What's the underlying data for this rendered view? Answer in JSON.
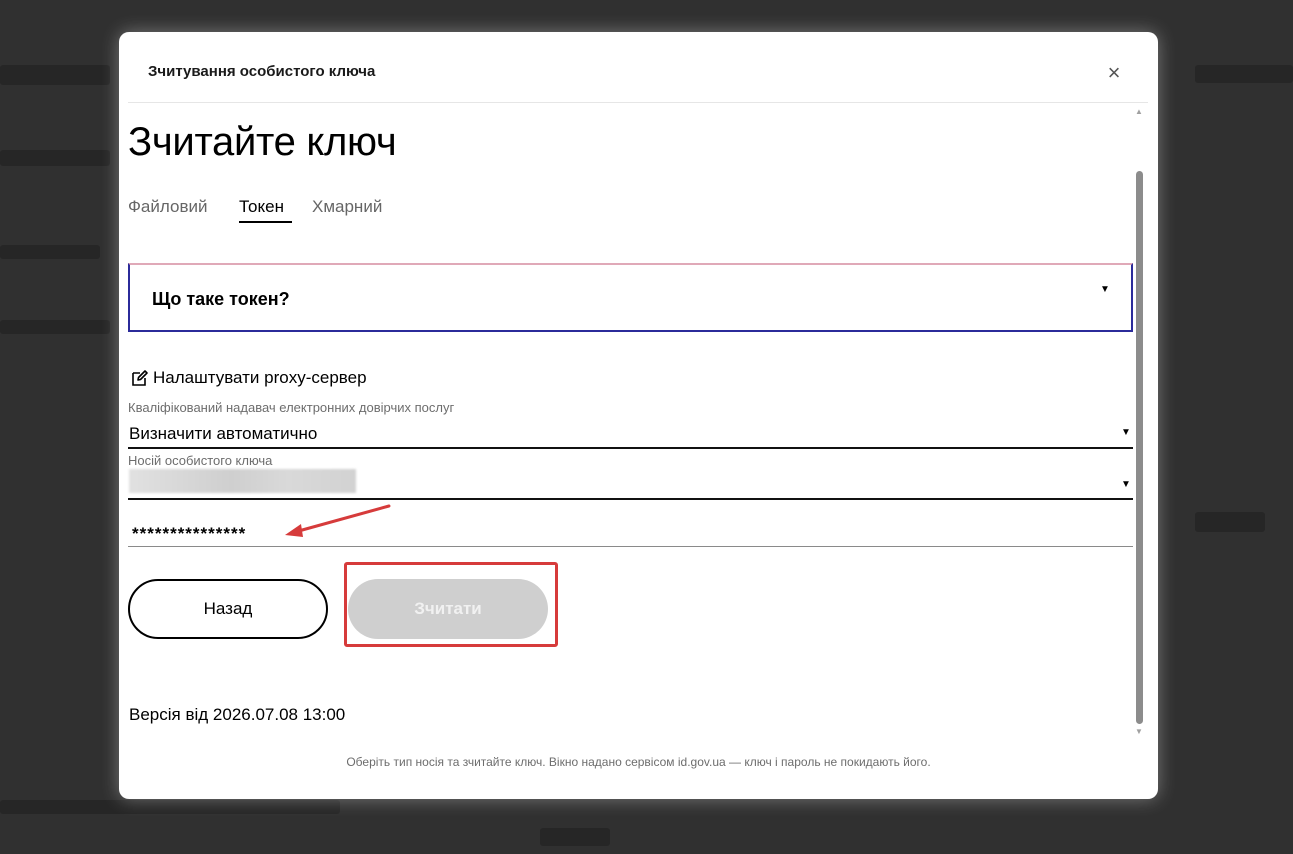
{
  "modal": {
    "title": "Зчитування особистого ключа",
    "close_label": "×"
  },
  "content": {
    "heading": "Зчитайте ключ",
    "tabs": [
      {
        "label": "Файловий",
        "active": false
      },
      {
        "label": "Токен",
        "active": true
      },
      {
        "label": "Хмарний",
        "active": false
      }
    ],
    "accordion": {
      "title": "Що таке токен?",
      "expanded": false
    },
    "proxy_link": "Налаштувати proxy-сервер",
    "provider": {
      "label": "Кваліфікований надавач електронних довірчих послуг",
      "value": "Визначити автоматично"
    },
    "key_carrier": {
      "label": "Носій особистого ключа",
      "value_redacted": true
    },
    "password": {
      "value": "***************"
    },
    "buttons": {
      "back": "Назад",
      "read": "Зчитати",
      "read_enabled": false
    },
    "version": "Версія від 2026.07.08 13:00"
  },
  "footer": {
    "note": "Оберіть тип носія та зчитайте ключ. Вікно надано сервісом id.gov.ua — ключ і пароль не покидають його."
  },
  "colors": {
    "accordion_border": "#2b2b9a",
    "annotation_red": "#d63b3b",
    "disabled_button": "#cfcfcf"
  }
}
